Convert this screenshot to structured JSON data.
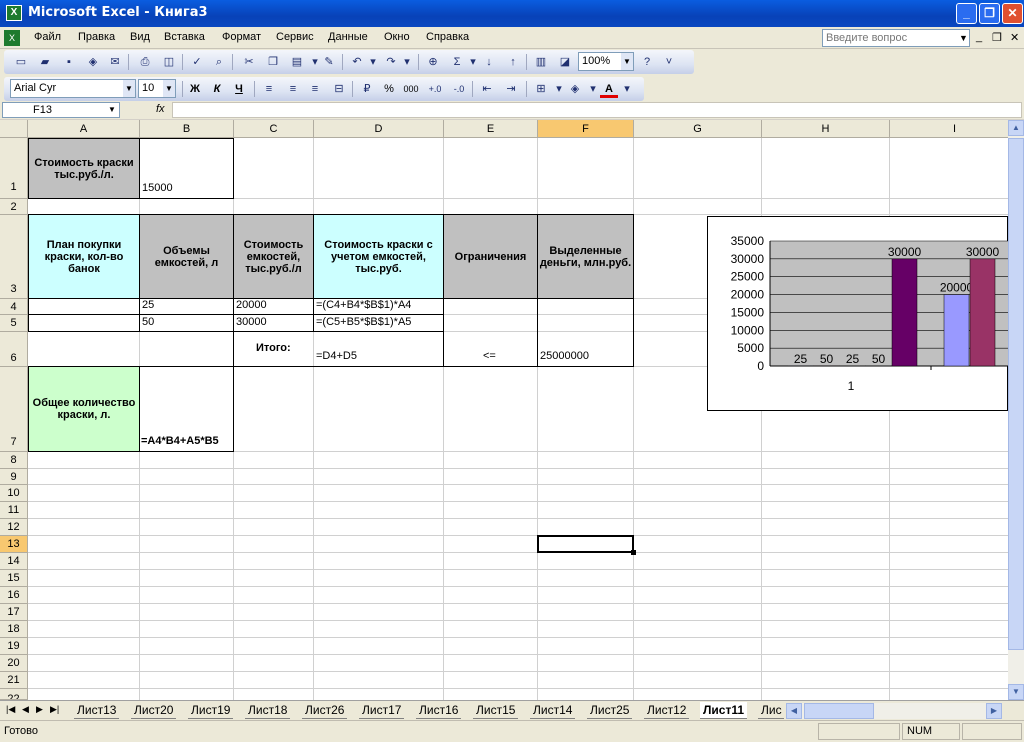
{
  "window": {
    "title": "Microsoft Excel - Книга3",
    "buttons": {
      "minimize": "_",
      "restore": "❐",
      "close": "✕"
    }
  },
  "menu": {
    "items": [
      "Файл",
      "Правка",
      "Вид",
      "Вставка",
      "Формат",
      "Сервис",
      "Данные",
      "Окно",
      "Справка"
    ],
    "help_placeholder": "Введите вопрос"
  },
  "standard_toolbar": {
    "zoom": "100%"
  },
  "formatting_toolbar": {
    "font": "Arial Cyr",
    "size": "10",
    "bold": "Ж",
    "italic": "К",
    "underline": "Ч",
    "percent": "%",
    "thousands": "000"
  },
  "formula_bar": {
    "name_box": "F13",
    "fx": "fx",
    "content": ""
  },
  "columns": [
    "A",
    "B",
    "C",
    "D",
    "E",
    "F",
    "G",
    "H",
    "I"
  ],
  "rows": [
    "1",
    "2",
    "3",
    "4",
    "5",
    "6",
    "7",
    "8",
    "9",
    "10",
    "11",
    "12",
    "13",
    "14",
    "15",
    "16",
    "17",
    "18",
    "19",
    "20",
    "21",
    "22"
  ],
  "cells": {
    "A1": "Стоимость краски тыс.руб./л.",
    "B1": "15000",
    "A3": "План покупки краски, кол-во банок",
    "B3": "Объемы емкостей, л",
    "C3": "Стоимость емкостей, тыс.руб./л",
    "D3": "Стоимость краски с учетом емкостей, тыс.руб.",
    "E3": "Ограничения",
    "F3": "Выделенные деньги, млн.руб.",
    "B4": "25",
    "C4": "20000",
    "D4": "=(C4+B4*$B$1)*A4",
    "B5": "50",
    "C5": "30000",
    "D5": "=(C5+B5*$B$1)*A5",
    "C6": "Итого:",
    "D6": "=D4+D5",
    "E6": "<=",
    "F6": "25000000",
    "A7": "Общее количество краски, л.",
    "B7": "=A4*B4+A5*B5"
  },
  "chart_data": {
    "type": "bar",
    "title": "",
    "categories": [
      "1"
    ],
    "yticks": [
      "35000",
      "30000",
      "25000",
      "20000",
      "15000",
      "10000",
      "5000",
      "0"
    ],
    "ylim": [
      0,
      35000
    ],
    "grid": true,
    "series": [
      {
        "values": [
          25
        ],
        "color": "#9999ff"
      },
      {
        "values": [
          50
        ],
        "color": "#993366"
      },
      {
        "values": [
          25
        ],
        "color": "#ffffcc"
      },
      {
        "values": [
          50
        ],
        "color": "#ccffff"
      },
      {
        "values": [
          30000
        ],
        "color": "#660066"
      },
      {
        "values": [
          0
        ],
        "color": "#ff8080"
      },
      {
        "values": [
          20000
        ],
        "color": "#9999ff"
      },
      {
        "values": [
          30000
        ],
        "color": "#993366"
      }
    ],
    "data_labels": [
      "25",
      "50",
      "25",
      "50",
      "30000",
      "20000",
      "30000"
    ],
    "plot_bg": "#c0c0c0"
  },
  "sheet_tabs": [
    "Лист13",
    "Лист20",
    "Лист19",
    "Лист18",
    "Лист26",
    "Лист17",
    "Лист16",
    "Лист15",
    "Лист14",
    "Лист25",
    "Лист12",
    "Лист11",
    "Лис"
  ],
  "active_tab": "Лист11",
  "status": {
    "text": "Готово",
    "num": "NUM"
  },
  "colors": {
    "fill_grey": "#c0c0c0",
    "fill_cyan": "#ccffff",
    "fill_green": "#ccffcc",
    "selected_header": "#f8c870"
  }
}
